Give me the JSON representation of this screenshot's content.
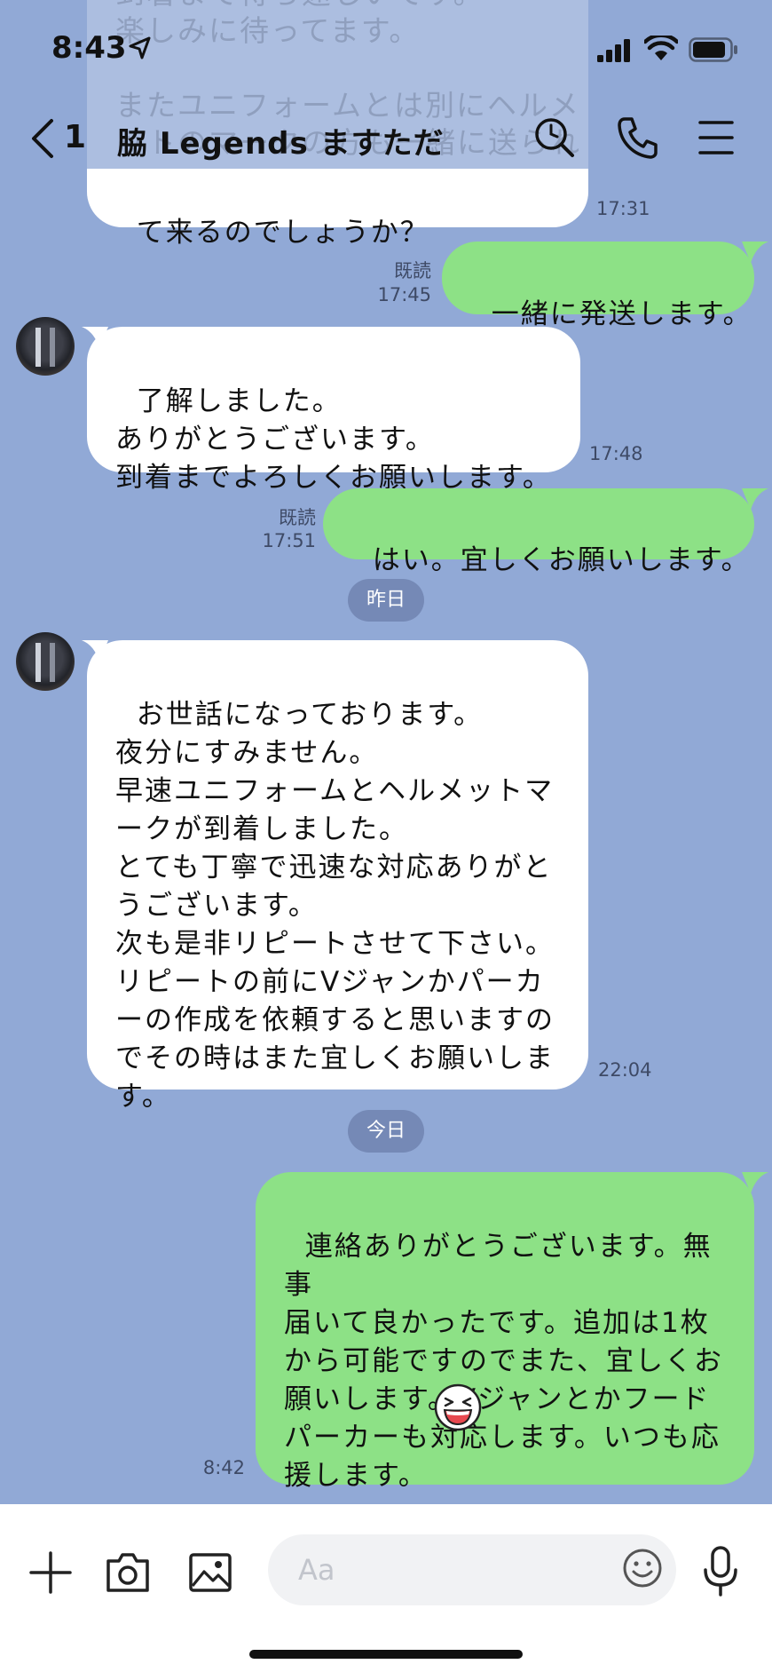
{
  "status_bar": {
    "time": "8:43"
  },
  "header": {
    "back_count": "1",
    "title": "脇 Legends ますただ"
  },
  "ghost_text": "到着まで待ち遠しいです。\n楽しみに待ってます。\n\nまたユニフォームとは別にヘルメ\nットのマークの方も一緒に送られ",
  "messages": [
    {
      "side": "in",
      "text": "て来るのでしょうか？",
      "time": "17:31"
    },
    {
      "side": "out",
      "text": "一緒に発送します。",
      "read": "既読",
      "time": "17:45"
    },
    {
      "side": "in",
      "text": "了解しました。\nありがとうございます。\n到着までよろしくお願いします。",
      "time": "17:48"
    },
    {
      "side": "out",
      "text": "はい。宜しくお願いします。",
      "read": "既読",
      "time": "17:51"
    },
    {
      "side": "in",
      "text": "お世話になっております。\n夜分にすみません。\n早速ユニフォームとヘルメットマ\nークが到着しました。\nとても丁寧で迅速な対応ありがと\nうございます。\n次も是非リピートさせて下さい。\nリピートの前にVジャンかパーカ\nーの作成を依頼すると思いますの\nでその時はまた宜しくお願いしま\nす。",
      "time": "22:04"
    },
    {
      "side": "out",
      "text": "連絡ありがとうございます。無事\n届いて良かったです。追加は1枚\nから可能ですのでまた、宜しくお\n願いします。Vジャンとかフード\nパーカーも対応します。いつも応\n援します。",
      "time": "8:42"
    }
  ],
  "date_separators": {
    "yesterday": "昨日",
    "today": "今日"
  },
  "input": {
    "placeholder": "Aa"
  },
  "colors": {
    "background": "#91a9d6",
    "outgoing": "#8de186",
    "incoming": "#ffffff"
  }
}
